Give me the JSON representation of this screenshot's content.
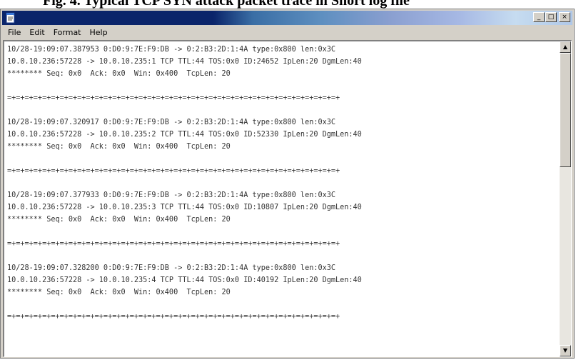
{
  "caption": "Fig. 4. Typical TCP SYN attack packet trace in Snort log file",
  "window": {
    "title": "",
    "controls": {
      "minimize": "_",
      "maximize": "□",
      "close": "×"
    }
  },
  "menu": [
    {
      "label": "File"
    },
    {
      "label": "Edit"
    },
    {
      "label": "Format"
    },
    {
      "label": "Help"
    }
  ],
  "log_lines": [
    "10/28-19:09:07.387953 0:D0:9:7E:F9:DB -> 0:2:B3:2D:1:4A type:0x800 len:0x3C",
    "10.0.10.236:57228 -> 10.0.10.235:1 TCP TTL:44 TOS:0x0 ID:24652 IpLen:20 DgmLen:40",
    "******** Seq: 0x0  Ack: 0x0  Win: 0x400  TcpLen: 20",
    "",
    "=+=+=+=+=+=+=+=+=+=+=+=+=+=+=+=+=+=+=+=+=+=+=+=+=+=+=+=+=+=+=+=+=+=+=+=+=+=+",
    "",
    "10/28-19:09:07.320917 0:D0:9:7E:F9:DB -> 0:2:B3:2D:1:4A type:0x800 len:0x3C",
    "10.0.10.236:57228 -> 10.0.10.235:2 TCP TTL:44 TOS:0x0 ID:52330 IpLen:20 DgmLen:40",
    "******** Seq: 0x0  Ack: 0x0  Win: 0x400  TcpLen: 20",
    "",
    "=+=+=+=+=+=+=+=+=+=+=+=+=+=+=+=+=+=+=+=+=+=+=+=+=+=+=+=+=+=+=+=+=+=+=+=+=+=+",
    "",
    "10/28-19:09:07.377933 0:D0:9:7E:F9:DB -> 0:2:B3:2D:1:4A type:0x800 len:0x3C",
    "10.0.10.236:57228 -> 10.0.10.235:3 TCP TTL:44 TOS:0x0 ID:10807 IpLen:20 DgmLen:40",
    "******** Seq: 0x0  Ack: 0x0  Win: 0x400  TcpLen: 20",
    "",
    "=+=+=+=+=+=+=+=+=+=+=+=+=+=+=+=+=+=+=+=+=+=+=+=+=+=+=+=+=+=+=+=+=+=+=+=+=+=+",
    "",
    "10/28-19:09:07.328200 0:D0:9:7E:F9:DB -> 0:2:B3:2D:1:4A type:0x800 len:0x3C",
    "10.0.10.236:57228 -> 10.0.10.235:4 TCP TTL:44 TOS:0x0 ID:40192 IpLen:20 DgmLen:40",
    "******** Seq: 0x0  Ack: 0x0  Win: 0x400  TcpLen: 20",
    "",
    "=+=+=+=+=+=+=+=+=+=+=+=+=+=+=+=+=+=+=+=+=+=+=+=+=+=+=+=+=+=+=+=+=+=+=+=+=+=+"
  ],
  "scrollbar": {
    "up": "▲",
    "down": "▼"
  },
  "colors": {
    "titlebar_start": "#0a246a",
    "window_face": "#d4d0c8"
  }
}
